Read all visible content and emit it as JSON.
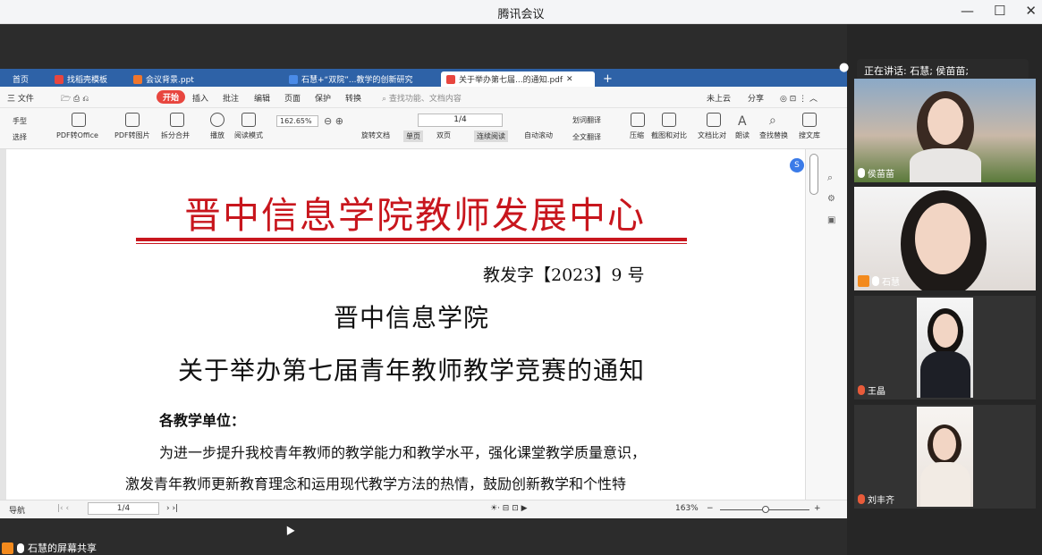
{
  "window": {
    "title": "腾讯会议"
  },
  "speaking": "正在讲话: 石慧; 侯苗苗;",
  "participants": [
    {
      "name": "侯苗苗"
    },
    {
      "name": "石慧"
    },
    {
      "name": "王晶"
    },
    {
      "name": "刘丰齐"
    }
  ],
  "share_label": "石慧的屏幕共享",
  "tabs": [
    "首页",
    "找稻壳模板",
    "会议背景.ppt",
    "石慧+“双院”...教学的创新研究",
    "关于举办第七届...的通知.pdf"
  ],
  "menu": {
    "file": "三 文件",
    "start": "开始",
    "items": [
      "插入",
      "批注",
      "编辑",
      "页面",
      "保护",
      "转换"
    ],
    "search": "查找功能、文档内容",
    "cloud": "未上云",
    "share": "分享"
  },
  "toolbar": {
    "hand": "手型",
    "select": "选择",
    "items": [
      "PDF转Office",
      "PDF转图片",
      "拆分合并",
      "播放",
      "阅读模式"
    ],
    "zoom": "162.65%",
    "rotate": "旋转文档",
    "single": "单页",
    "double": "双页",
    "continuous": "连续阅读",
    "autoscroll": "自动滚动",
    "page": "1/4",
    "right_items": [
      "划词翻译",
      "全文翻译",
      "压缩",
      "截图和对比",
      "文档比对",
      "朗读",
      "查找替换",
      "搜文库"
    ]
  },
  "document": {
    "header": "晋中信息学院教师发展中心",
    "doc_number": "教发字【2023】9 号",
    "school": "晋中信息学院",
    "title": "关于举办第七届青年教师教学竞赛的通知",
    "salutation": "各教学单位：",
    "para1": "为进一步提升我校青年教师的教学能力和教学水平，强化课堂教学质量意识，",
    "para2": "激发青年教师更新教育理念和运用现代教学方法的热情，鼓励创新教学和个性特"
  },
  "status": {
    "nav": "导航",
    "page": "1/4",
    "zoom": "163%"
  },
  "colors": {
    "accent": "#c8161d",
    "tabbar": "#2e62a7"
  }
}
